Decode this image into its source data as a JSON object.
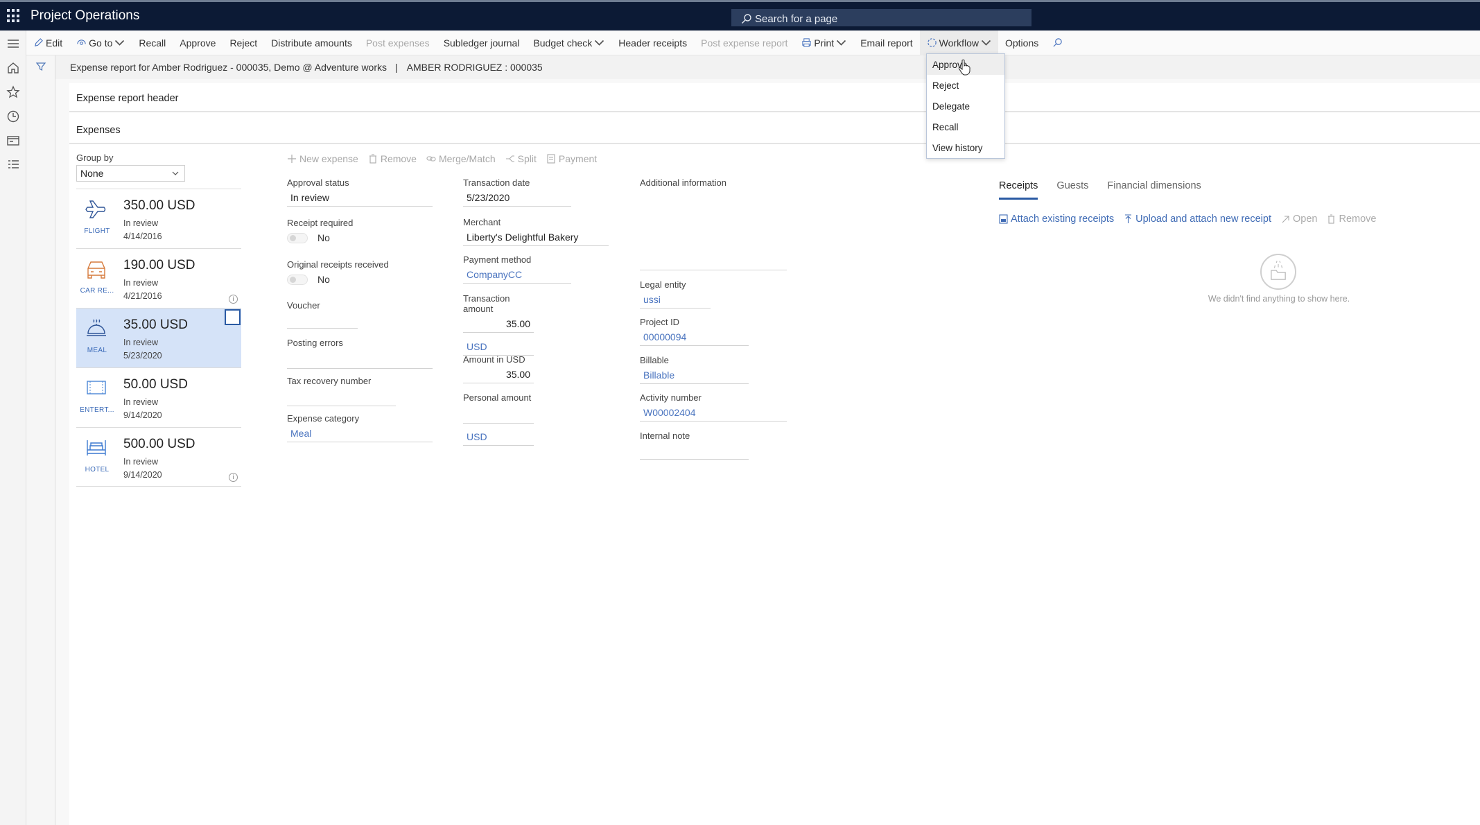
{
  "app": {
    "title": "Project Operations",
    "search_placeholder": "Search for a page"
  },
  "actionbar": {
    "items": [
      {
        "label": "Edit",
        "icon": "pencil-icon",
        "disabled": false
      },
      {
        "label": "Go to",
        "icon": "goto-icon",
        "dropdown": true,
        "disabled": false
      },
      {
        "label": "Recall",
        "disabled": false
      },
      {
        "label": "Approve",
        "disabled": false
      },
      {
        "label": "Reject",
        "disabled": false
      },
      {
        "label": "Distribute amounts",
        "disabled": false
      },
      {
        "label": "Post expenses",
        "disabled": true
      },
      {
        "label": "Subledger journal",
        "disabled": false
      },
      {
        "label": "Budget check",
        "dropdown": true,
        "disabled": false
      },
      {
        "label": "Header receipts",
        "disabled": false
      },
      {
        "label": "Post expense report",
        "disabled": true
      },
      {
        "label": "Print",
        "icon": "printer-icon",
        "dropdown": true,
        "disabled": false
      },
      {
        "label": "Email report",
        "disabled": false
      },
      {
        "label": "Workflow",
        "icon": "workflow-icon",
        "dropdown": true,
        "disabled": false,
        "active": true
      },
      {
        "label": "Options",
        "disabled": false
      }
    ]
  },
  "workflow_menu": {
    "items": [
      "Approve",
      "Reject",
      "Delegate",
      "Recall",
      "View history"
    ],
    "hovered": "Approve"
  },
  "breadcrumb": {
    "text": "Expense report for Amber Rodriguez - 000035, Demo @ Adventure works",
    "separator": "|",
    "record": "AMBER RODRIGUEZ : 000035"
  },
  "sections": {
    "header": "Expense report header",
    "expenses": "Expenses"
  },
  "group_by": {
    "label": "Group by",
    "value": "None"
  },
  "expenses": [
    {
      "amount": "350.00 USD",
      "status": "In review",
      "date": "4/14/2016",
      "category": "FLIGHT",
      "icon": "airplane-icon",
      "color": "#2f5597",
      "selected": false,
      "info": false
    },
    {
      "amount": "190.00 USD",
      "status": "In review",
      "date": "4/21/2016",
      "category": "CAR RE...",
      "icon": "car-icon",
      "color": "#d67a3c",
      "selected": false,
      "info": true
    },
    {
      "amount": "35.00 USD",
      "status": "In review",
      "date": "5/23/2020",
      "category": "MEAL",
      "icon": "meal-cloche-icon",
      "color": "#2f5597",
      "selected": true,
      "info": false
    },
    {
      "amount": "50.00 USD",
      "status": "In review",
      "date": "9/14/2020",
      "category": "ENTERT...",
      "icon": "ticket-icon",
      "color": "#4a86d6",
      "selected": false,
      "info": false
    },
    {
      "amount": "500.00 USD",
      "status": "In review",
      "date": "9/14/2020",
      "category": "HOTEL",
      "icon": "bed-icon",
      "color": "#3b79d0",
      "selected": false,
      "info": true
    }
  ],
  "line_toolbar": {
    "new_expense": "New expense",
    "remove": "Remove",
    "merge_match": "Merge/Match",
    "split": "Split",
    "payment": "Payment"
  },
  "details": {
    "approval_status": {
      "label": "Approval status",
      "value": "In review"
    },
    "receipt_required": {
      "label": "Receipt required",
      "value": "No"
    },
    "original_receipts": {
      "label": "Original receipts received",
      "value": "No"
    },
    "voucher": {
      "label": "Voucher",
      "value": ""
    },
    "posting_errors": {
      "label": "Posting errors",
      "value": ""
    },
    "tax_recovery": {
      "label": "Tax recovery number",
      "value": ""
    },
    "expense_category": {
      "label": "Expense category",
      "value": "Meal"
    },
    "transaction_date": {
      "label": "Transaction date",
      "value": "5/23/2020"
    },
    "merchant": {
      "label": "Merchant",
      "value": "Liberty's Delightful Bakery"
    },
    "payment_method": {
      "label": "Payment method",
      "value": "CompanyCC"
    },
    "transaction_amount": {
      "label": "Transaction amount",
      "value": "35.00",
      "currency": "USD"
    },
    "amount_usd": {
      "label": "Amount in USD",
      "value": "35.00"
    },
    "personal_amount": {
      "label": "Personal amount",
      "value": "",
      "currency": "USD"
    },
    "additional_info": {
      "label": "Additional information",
      "value": ""
    },
    "legal_entity": {
      "label": "Legal entity",
      "value": "ussi"
    },
    "project_id": {
      "label": "Project ID",
      "value": "00000094"
    },
    "billable": {
      "label": "Billable",
      "value": "Billable"
    },
    "activity_number": {
      "label": "Activity number",
      "value": "W00002404"
    },
    "internal_note": {
      "label": "Internal note",
      "value": ""
    }
  },
  "receipts_panel": {
    "tabs": [
      "Receipts",
      "Guests",
      "Financial dimensions"
    ],
    "active_tab": "Receipts",
    "actions": {
      "attach_existing": "Attach existing receipts",
      "upload_attach": "Upload and attach new receipt",
      "open": "Open",
      "remove": "Remove"
    },
    "empty_message": "We didn't find anything to show here."
  },
  "colors": {
    "topbar": "#0c1a35",
    "accent": "#2a5aa3",
    "link": "#4a74bf",
    "selected_row": "#d5e3f8"
  }
}
